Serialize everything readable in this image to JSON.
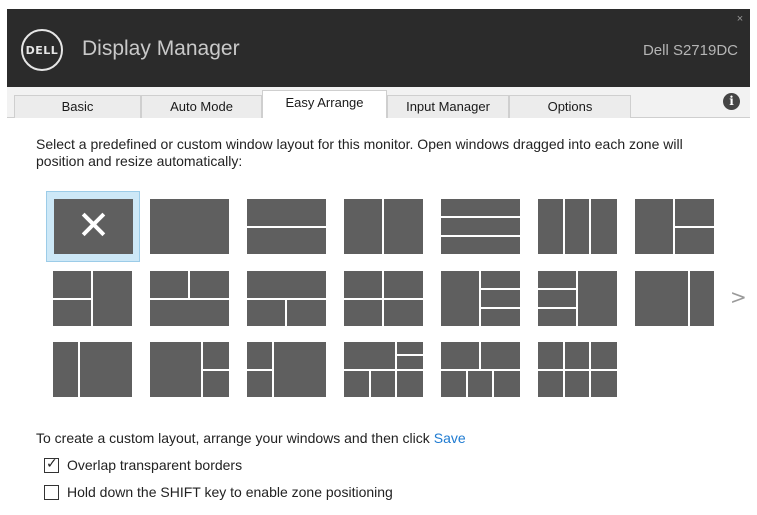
{
  "window": {
    "logo_text": "DELL",
    "title": "Display Manager",
    "monitor": "Dell S2719DC",
    "close_symbol": "×"
  },
  "tabs": [
    {
      "label": "Basic",
      "active": false
    },
    {
      "label": "Auto Mode",
      "active": false
    },
    {
      "label": "Easy Arrange",
      "active": true
    },
    {
      "label": "Input Manager",
      "active": false
    },
    {
      "label": "Options",
      "active": false
    }
  ],
  "info_icon": "i",
  "description": "Select a predefined or custom window layout for this monitor.  Open windows dragged into each zone will position and resize automatically:",
  "layouts": {
    "selected_symbol": "✕",
    "next_symbol": ">",
    "rows": [
      [
        "none-selected",
        "single",
        "two-horizontal",
        "two-vertical",
        "three-horizontal",
        "three-vertical",
        "left-plus-right-split"
      ],
      [
        "left-split-plus-right",
        "top-split-plus-bottom",
        "top-plus-bottom-split",
        "quad",
        "left-plus-right-triple",
        "left-triple-plus-right",
        "wide-left-narrow-right"
      ],
      [
        "narrow-left-wide-right",
        "wide-left-plus-right-split",
        "left-split-plus-wide-right",
        "mixed-grid-a",
        "mixed-grid-b",
        "six-grid"
      ]
    ]
  },
  "custom": {
    "text": "To create a custom layout, arrange your windows and then click",
    "save_label": "Save"
  },
  "options": [
    {
      "label": "Overlap transparent borders",
      "checked": true
    },
    {
      "label": "Hold down the SHIFT key to enable zone positioning",
      "checked": false
    }
  ]
}
